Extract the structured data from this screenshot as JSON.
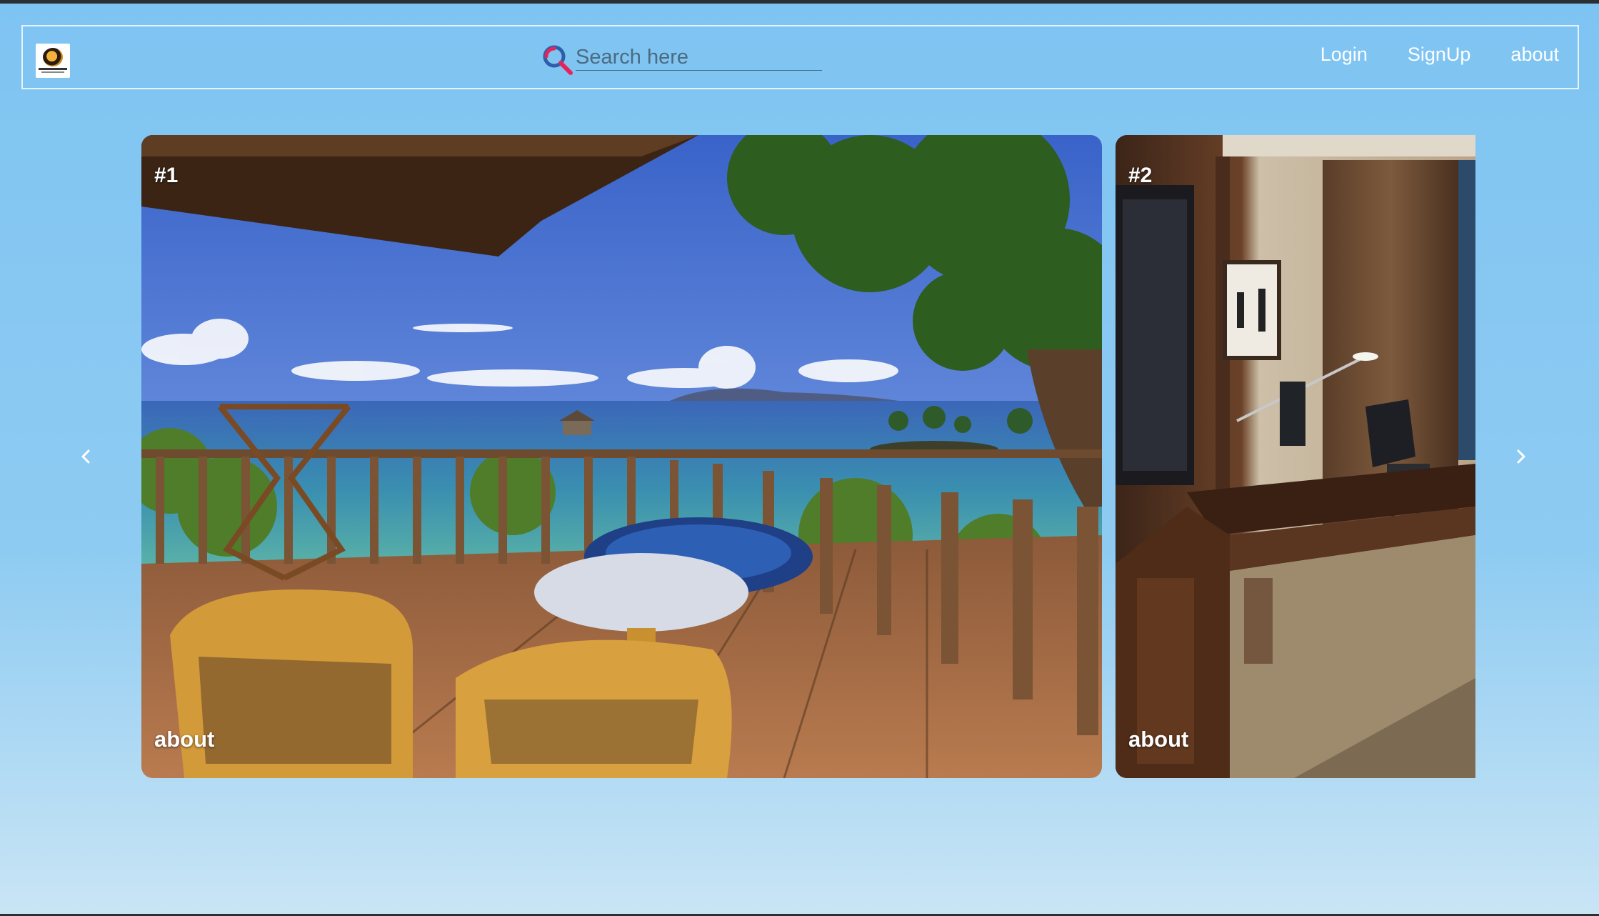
{
  "header": {
    "logo_icon": "hotel-logo-icon",
    "search": {
      "icon": "search-icon",
      "placeholder": "Search here",
      "value": ""
    },
    "nav": [
      {
        "label": "Login"
      },
      {
        "label": "SignUp"
      },
      {
        "label": "about"
      }
    ]
  },
  "carousel": {
    "prev_icon": "chevron-left-icon",
    "next_icon": "chevron-right-icon",
    "slides": [
      {
        "rank": "#1",
        "caption": "about",
        "image": "beach-terrace-photo"
      },
      {
        "rank": "#2",
        "caption": "about",
        "image": "hotel-room-desk-photo"
      }
    ]
  },
  "colors": {
    "background_top": "#7ec4f2",
    "background_bottom": "#c9e5f5",
    "search_icon_blue": "#2d5fa8",
    "search_icon_pink": "#e5245e"
  }
}
